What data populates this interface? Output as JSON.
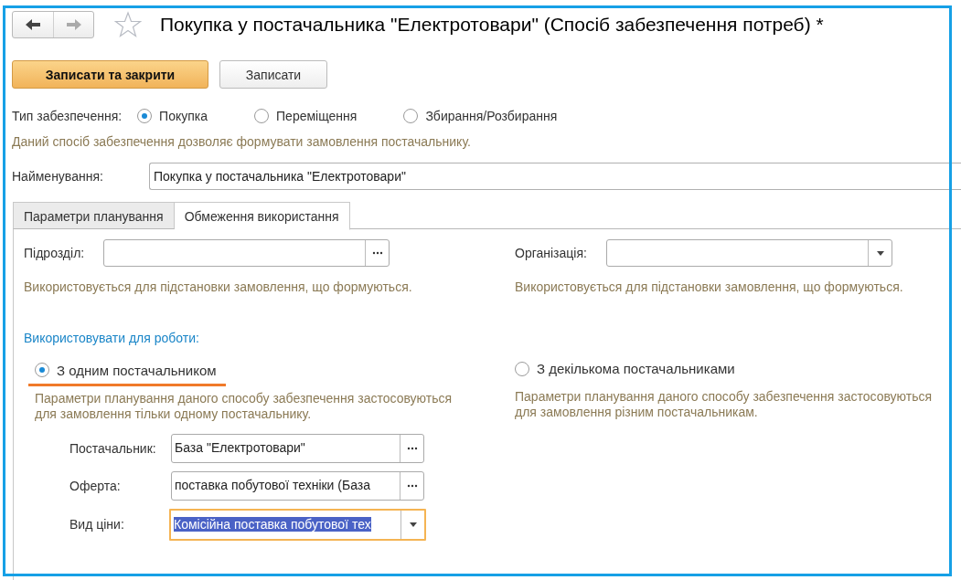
{
  "title": "Покупка у постачальника \"Електротовари\" (Спосіб забезпечення потреб) *",
  "buttons": [
    {
      "label": "Записати та закрити",
      "kind": "primary"
    },
    {
      "label": "Записати",
      "kind": "default"
    }
  ],
  "supply_type": {
    "label": "Тип забезпечення:",
    "options": [
      {
        "label": "Покупка",
        "selected": true
      },
      {
        "label": "Переміщення",
        "selected": false
      },
      {
        "label": "Збирання/Розбирання",
        "selected": false
      }
    ]
  },
  "supply_hint": "Даний спосіб забезпечення дозволяє формувати замовлення постачальнику.",
  "name_field": {
    "label": "Найменування:",
    "value": "Покупка у постачальника \"Електротовари\""
  },
  "tabs": [
    {
      "label": "Параметри планування",
      "selected": false
    },
    {
      "label": "Обмеження використання",
      "selected": true
    }
  ],
  "restrictions": [
    {
      "label": "Підрозділ:",
      "kind": "choice",
      "hint": "Використовується для підстановки замовлення, що формуються."
    },
    {
      "label": "Організація:",
      "kind": "dropdown",
      "hint": "Використовується для підстановки замовлення, що формуються."
    }
  ],
  "use_for": {
    "label": "Використовувати для роботи:",
    "options": [
      {
        "label": "З одним постачальником",
        "selected": true,
        "hint": "Параметри планування даного способу забезпечення застосовуються для замовлення тільки одному постачальнику."
      },
      {
        "label": "З декількома постачальниками",
        "selected": false,
        "hint": "Параметри планування даного способу забезпечення застосовуються для замовлення різним постачальникам."
      }
    ]
  },
  "supplier_fields": [
    {
      "label": "Постачальник:",
      "value": "База \"Електротовари\"",
      "kind": "choice",
      "focused": false
    },
    {
      "label": "Оферта:",
      "value": "поставка побутової техніки (База",
      "kind": "choice",
      "focused": false
    },
    {
      "label": "Вид ціни:",
      "value": "Комісійна поставка побутової тех",
      "kind": "dropdown",
      "focused": true
    }
  ]
}
